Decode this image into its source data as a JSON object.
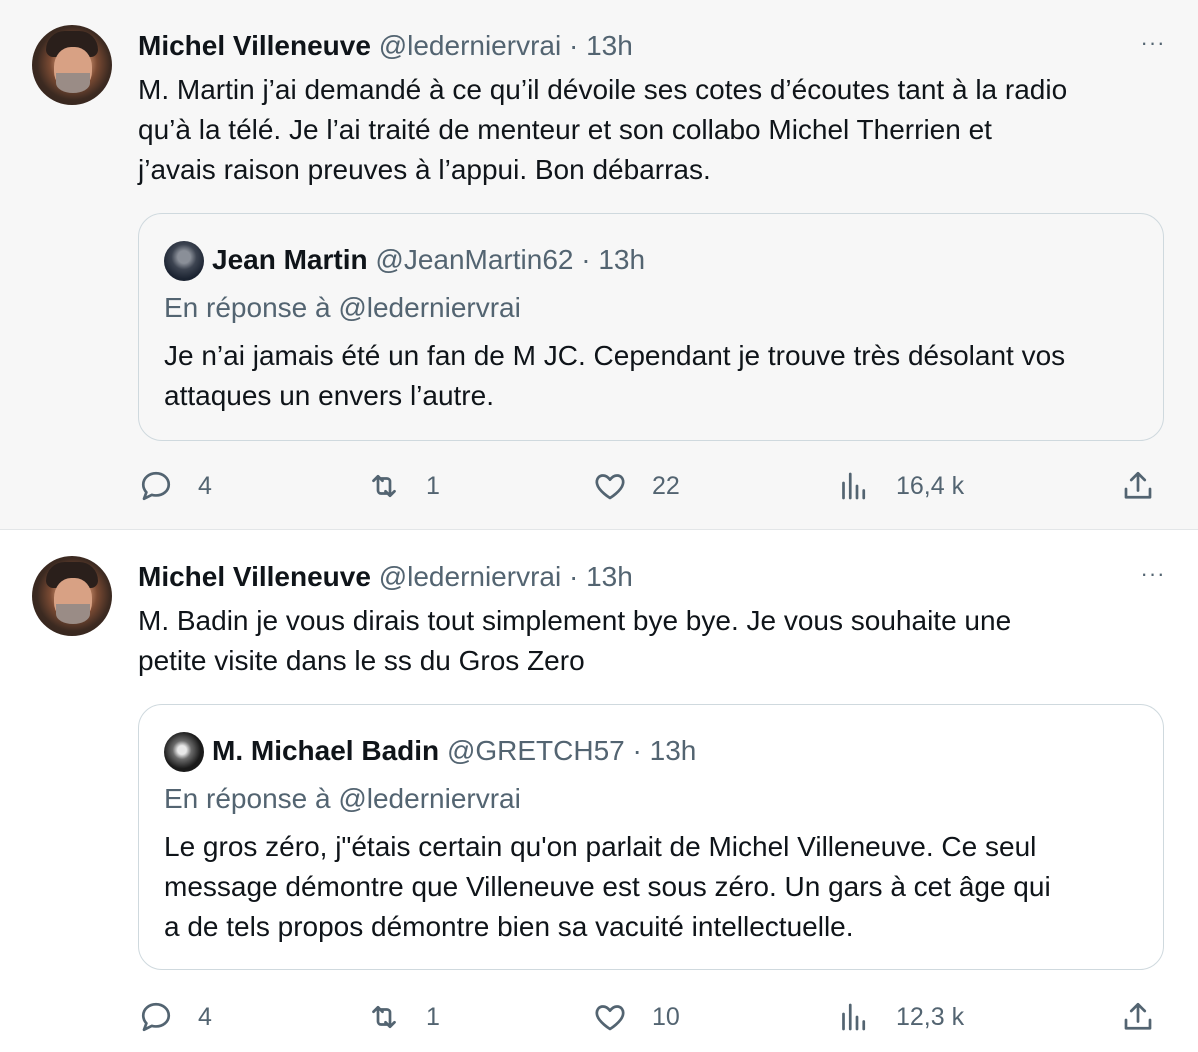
{
  "tweets": [
    {
      "author_name": "Michel Villeneuve",
      "handle": "@lederniervrai",
      "time": "13h",
      "text": "M. Martin j’ai demandé à ce qu’il dévoile ses cotes d’écoutes tant à la radio\nqu’à la télé.  Je l’ai traité de menteur et son collabo Michel Therrien et\nj’avais raison preuves à l’appui.  Bon débarras.",
      "quote": {
        "author_name": "Jean Martin",
        "handle": "@JeanMartin62",
        "time": "13h",
        "reply_to": "En réponse à @lederniervrai",
        "text": "Je n’ai jamais été un fan de M JC. Cependant je trouve très désolant vos\nattaques un envers l’autre."
      },
      "stats": {
        "replies": "4",
        "retweets": "1",
        "likes": "22",
        "views": "16,4 k"
      }
    },
    {
      "author_name": "Michel Villeneuve",
      "handle": "@lederniervrai",
      "time": "13h",
      "text": "M.  Badin je vous dirais tout simplement bye bye.   Je vous souhaite une\npetite visite dans le ss du Gros Zero",
      "quote": {
        "author_name": "M. Michael Badin",
        "handle": "@GRETCH57",
        "time": "13h",
        "reply_to": "En réponse à @lederniervrai",
        "text": "Le gros zéro, j\"étais certain qu'on parlait de Michel Villeneuve. Ce seul\nmessage démontre que Villeneuve est sous zéro. Un gars à cet âge qui\na de tels  propos démontre bien sa vacuité intellectuelle."
      },
      "stats": {
        "replies": "4",
        "retweets": "1",
        "likes": "10",
        "views": "12,3 k"
      }
    }
  ],
  "separator": "·",
  "more_label": "···",
  "icons": {
    "reply": "reply-icon",
    "retweet": "retweet-icon",
    "like": "heart-icon",
    "views": "views-icon",
    "share": "share-icon"
  },
  "colors": {
    "secondary_text": "#536471",
    "primary_text": "#0f1419",
    "border": "#cfd9de"
  }
}
